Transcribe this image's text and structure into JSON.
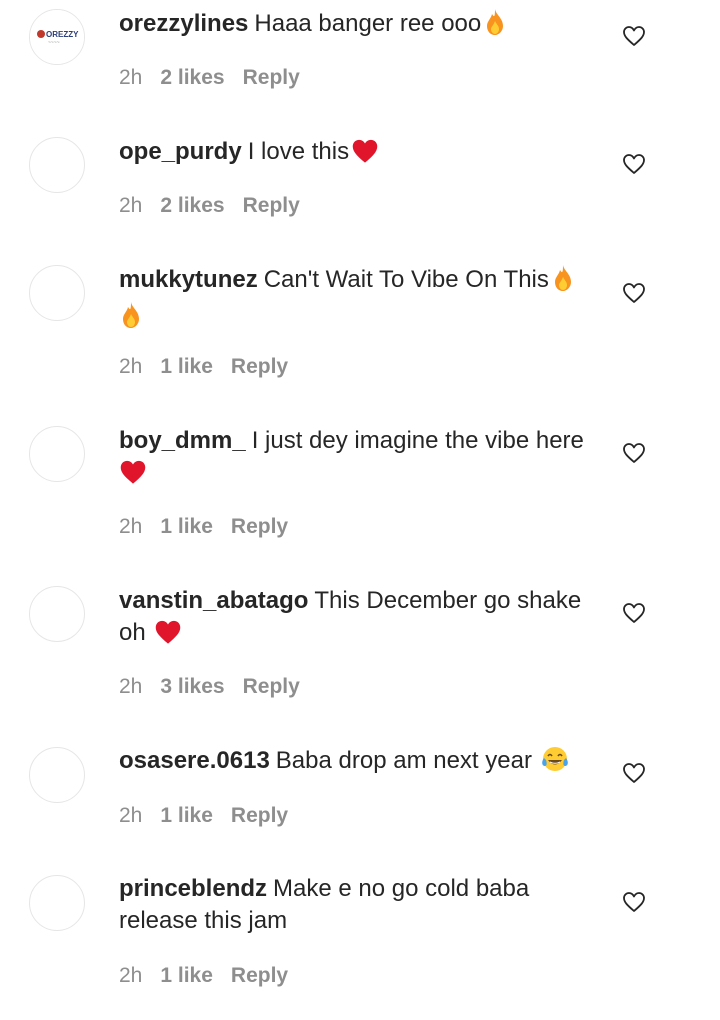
{
  "comments": [
    {
      "username": "orezzylines",
      "text": "Haaa banger ree ooo",
      "emoji": "fire-icon",
      "time": "2h",
      "likes": "2 likes",
      "reply": "Reply",
      "avatar": "orezzy-logo"
    },
    {
      "username": "ope_purdy",
      "text": "I love this",
      "emoji": "red-heart-icon",
      "time": "2h",
      "likes": "2 likes",
      "reply": "Reply",
      "avatar": "blank"
    },
    {
      "username": "mukkytunez",
      "text": "Can't Wait To Vibe On This",
      "emoji": "fire-icon",
      "emoji2": "fire-icon",
      "time": "2h",
      "likes": "1 like",
      "reply": "Reply",
      "avatar": "blank"
    },
    {
      "username": "boy_dmm_",
      "text": "I just dey imagine the vibe here",
      "emoji": "red-heart-icon",
      "time": "2h",
      "likes": "1 like",
      "reply": "Reply",
      "avatar": "blank"
    },
    {
      "username": "vanstin_abatago",
      "text": "This December go shake oh",
      "emoji": "red-heart-icon",
      "time": "2h",
      "likes": "3 likes",
      "reply": "Reply",
      "avatar": "blank"
    },
    {
      "username": "osasere.0613",
      "text": "Baba drop am next year",
      "emoji": "joy-face-icon",
      "time": "2h",
      "likes": "1 like",
      "reply": "Reply",
      "avatar": "blank"
    },
    {
      "username": "princeblendz",
      "text": "Make e no go cold baba release this jam",
      "time": "2h",
      "likes": "1 like",
      "reply": "Reply",
      "avatar": "blank"
    }
  ],
  "logo_text": {
    "main": "OREZZY",
    "sub": "~~~~"
  },
  "colors": {
    "text": "#262626",
    "meta": "#8e8e8e",
    "avatar_border": "#e6e6e6",
    "heart_red": "#e0142b",
    "fire_orange": "#f7931e",
    "fire_yellow": "#ffcc33"
  }
}
